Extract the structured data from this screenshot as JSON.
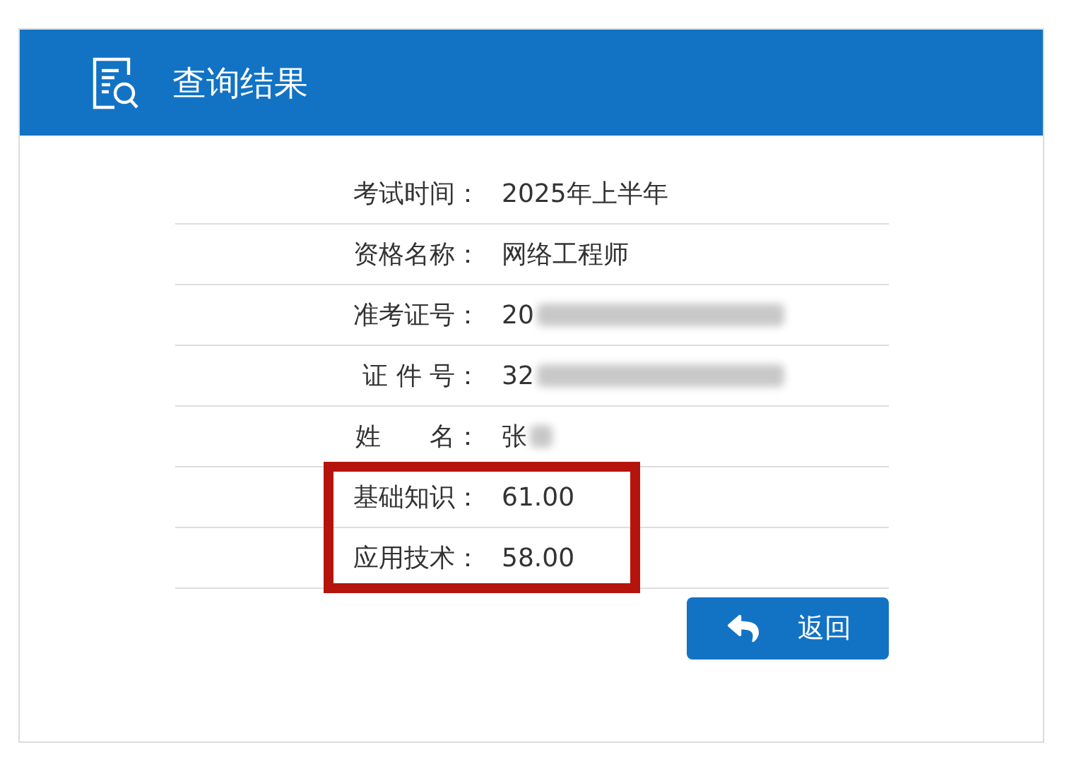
{
  "header": {
    "title": "查询结果"
  },
  "rows": [
    {
      "label": "考试时间：",
      "value": "2025年上半年",
      "redacted": false,
      "highlighted": false
    },
    {
      "label": "资格名称：",
      "value": "网络工程师",
      "redacted": false,
      "highlighted": false
    },
    {
      "label": "准考证号：",
      "value": "20",
      "redacted": true,
      "highlighted": false
    },
    {
      "label": "证 件 号：",
      "value": "32",
      "redacted": true,
      "highlighted": false
    },
    {
      "label": "姓      名：",
      "value": "张",
      "redacted": true,
      "highlighted": false
    },
    {
      "label": "基础知识：",
      "value": "61.00",
      "redacted": false,
      "highlighted": true
    },
    {
      "label": "应用技术：",
      "value": "58.00",
      "redacted": false,
      "highlighted": true
    }
  ],
  "back_button": {
    "label": "返回"
  }
}
